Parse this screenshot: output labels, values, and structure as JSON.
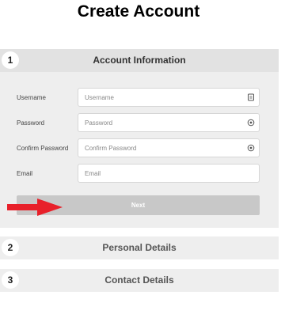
{
  "page": {
    "title": "Create Account"
  },
  "steps": [
    {
      "number": "1",
      "title": "Account Information"
    },
    {
      "number": "2",
      "title": "Personal Details"
    },
    {
      "number": "3",
      "title": "Contact Details"
    }
  ],
  "form": {
    "username": {
      "label": "Username",
      "placeholder": "Username",
      "value": "",
      "icon": "id-card-icon"
    },
    "password": {
      "label": "Password",
      "placeholder": "Password",
      "value": "",
      "icon": "eye-icon"
    },
    "confirm_password": {
      "label": "Confirm Password",
      "placeholder": "Confirm Password",
      "value": "",
      "icon": "eye-icon"
    },
    "email": {
      "label": "Email",
      "placeholder": "Email",
      "value": ""
    },
    "next_label": "Next"
  },
  "annotation": {
    "icon": "red-arrow-icon",
    "color": "#e8202a"
  },
  "colors": {
    "button_disabled": "#c8c8c8",
    "section_bg": "#eeeeee",
    "header_bg": "#e2e2e2"
  }
}
